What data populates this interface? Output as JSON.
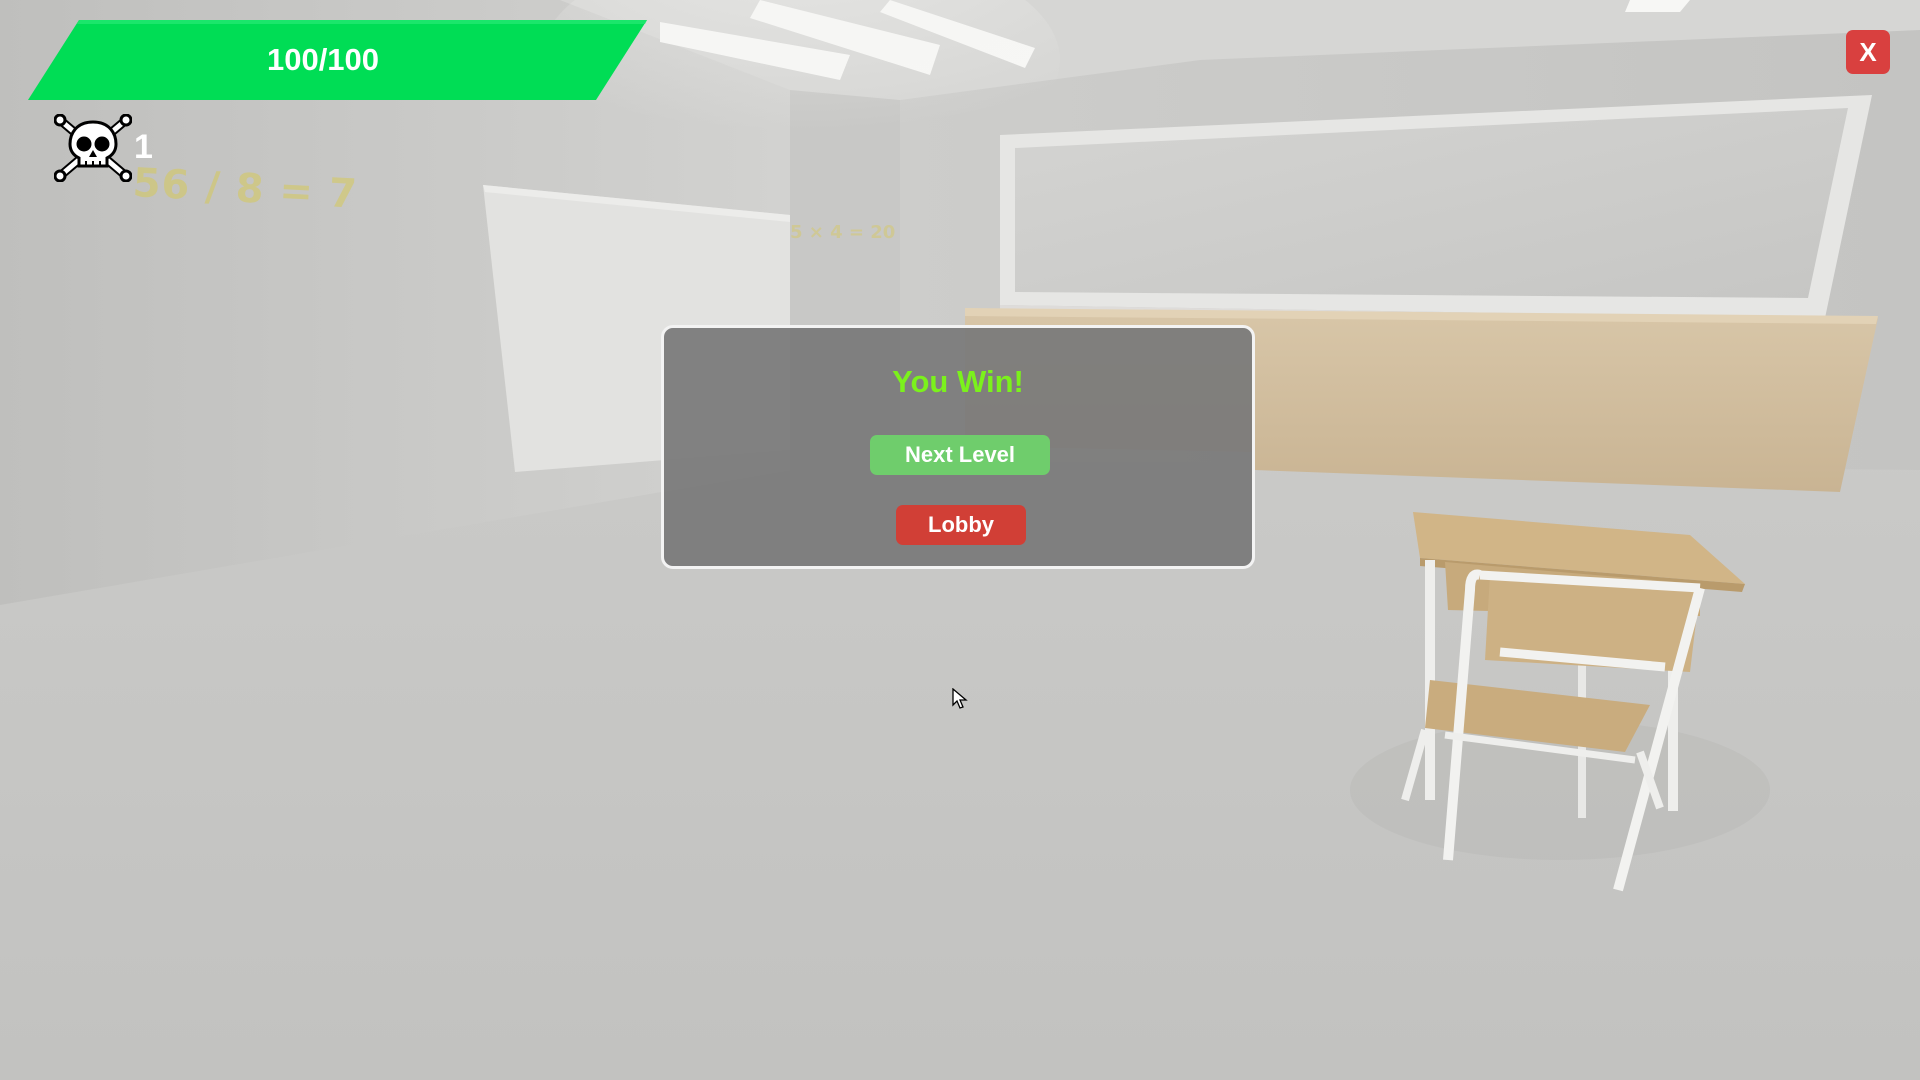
{
  "hud": {
    "health_label": "100/100",
    "health_fraction": 1.0,
    "health_color": "#00dd55",
    "kill_count": "1",
    "kill_icon": "skull-crossbones-icon",
    "close_label": "X",
    "close_color": "#d9403f"
  },
  "scene": {
    "equation_near": "56 / 8 = 7",
    "equation_far": "5 × 4 = 20"
  },
  "dialog": {
    "title": "You Win!",
    "title_color": "#7bf11c",
    "next_level_label": "Next Level",
    "next_level_color": "#6fcd6c",
    "lobby_label": "Lobby",
    "lobby_color": "#d13f36"
  }
}
